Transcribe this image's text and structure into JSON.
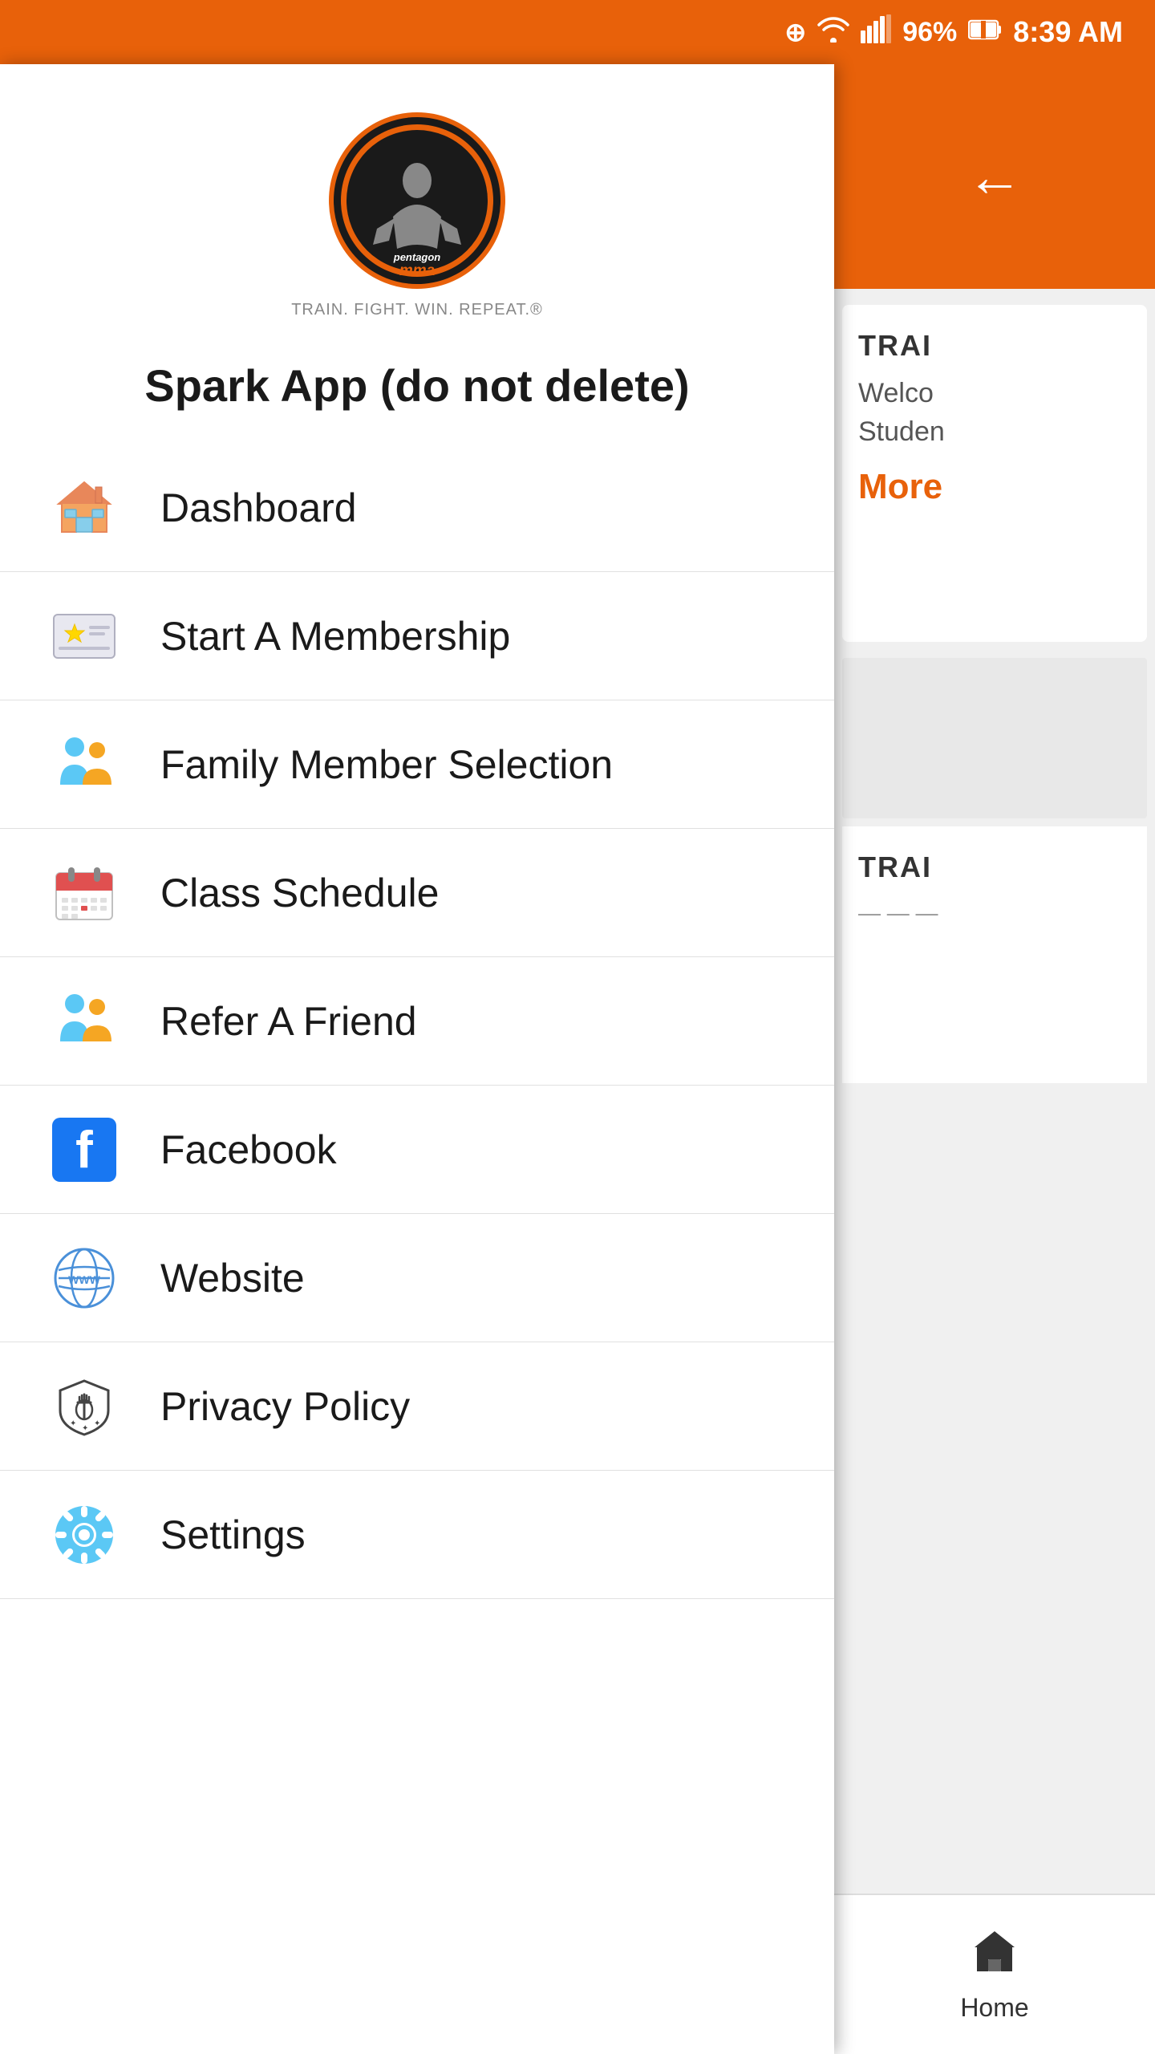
{
  "statusBar": {
    "battery": "96%",
    "time": "8:39 AM",
    "icons": {
      "circleplus": "⊕",
      "wifi": "📶",
      "signal": "📶",
      "battery_icon": "🔋"
    }
  },
  "drawer": {
    "logo": {
      "text_top": "pentagon",
      "text_bottom": "mma",
      "tagline": "TRAIN. FIGHT. WIN. REPEAT.®"
    },
    "appTitle": "Spark App (do not delete)",
    "menuItems": [
      {
        "id": "dashboard",
        "label": "Dashboard",
        "icon": "house"
      },
      {
        "id": "start-membership",
        "label": "Start A Membership",
        "icon": "card"
      },
      {
        "id": "family-member",
        "label": "Family Member Selection",
        "icon": "people"
      },
      {
        "id": "class-schedule",
        "label": "Class Schedule",
        "icon": "calendar"
      },
      {
        "id": "refer-friend",
        "label": "Refer A Friend",
        "icon": "people2"
      },
      {
        "id": "facebook",
        "label": "Facebook",
        "icon": "facebook"
      },
      {
        "id": "website",
        "label": "Website",
        "icon": "www"
      },
      {
        "id": "privacy-policy",
        "label": "Privacy Policy",
        "icon": "shield"
      },
      {
        "id": "settings",
        "label": "Settings",
        "icon": "gear"
      }
    ]
  },
  "rightPanel": {
    "backLabel": "←",
    "card1": {
      "title": "TRAI",
      "text": "Welco\nStuden",
      "more": "More"
    },
    "card2": {
      "title": "TRAI"
    },
    "bottomNav": {
      "label": "Home"
    }
  }
}
